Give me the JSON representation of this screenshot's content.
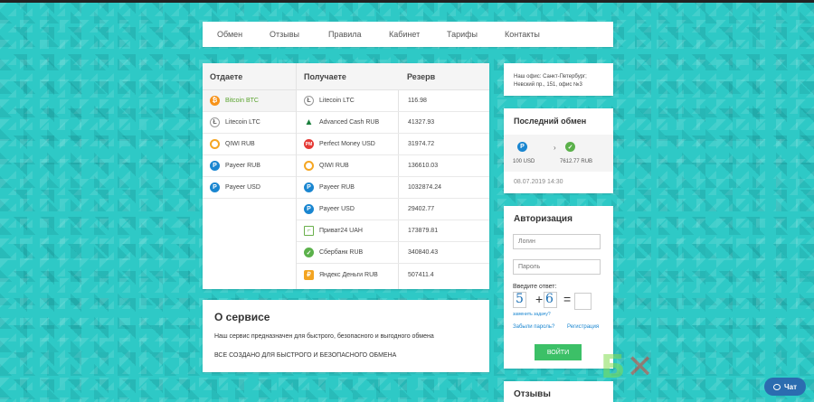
{
  "nav": [
    "Обмен",
    "Отзывы",
    "Правила",
    "Кабинет",
    "Тарифы",
    "Контакты"
  ],
  "exchange": {
    "headers": {
      "give": "Отдаете",
      "get": "Получаете",
      "reserve": "Резерв"
    },
    "give": [
      {
        "icon": "bitcoin-icon",
        "label": "Bitcoin BTC",
        "active": true
      },
      {
        "icon": "litecoin-icon",
        "label": "Litecoin LTC"
      },
      {
        "icon": "qiwi-icon",
        "label": "QIWI RUB"
      },
      {
        "icon": "payeer-icon",
        "label": "Payeer RUB"
      },
      {
        "icon": "payeer-icon",
        "label": "Payeer USD"
      }
    ],
    "get": [
      {
        "icon": "litecoin-icon",
        "label": "Litecoin LTC",
        "reserve": "116.98"
      },
      {
        "icon": "advcash-icon",
        "label": "Advanced Cash RUB",
        "reserve": "41327.93"
      },
      {
        "icon": "perfect-money-icon",
        "label": "Perfect Money USD",
        "reserve": "31974.72"
      },
      {
        "icon": "qiwi-icon",
        "label": "QIWI RUB",
        "reserve": "136610.03"
      },
      {
        "icon": "payeer-icon",
        "label": "Payeer RUB",
        "reserve": "1032874.24"
      },
      {
        "icon": "payeer-icon",
        "label": "Payeer USD",
        "reserve": "29402.77"
      },
      {
        "icon": "privat24-icon",
        "label": "Приват24 UAH",
        "reserve": "173879.81"
      },
      {
        "icon": "sberbank-icon",
        "label": "Сбербанк RUB",
        "reserve": "340840.43"
      },
      {
        "icon": "yandex-money-icon",
        "label": "Яндекс Деньги RUB",
        "reserve": "507411.4"
      }
    ]
  },
  "about": {
    "title": "О сервисе",
    "text1": "Наш сервис предназначен для быстрого, безопасного и выгодного обмена",
    "text2": "ВСЕ СОЗДАНО ДЛЯ БЫСТРОГО И БЕЗОПАСНОГО ОБМЕНА"
  },
  "office": "Наш офис: Санкт-Петербург; Невский пр., 151, офис №3",
  "last_exchange": {
    "title": "Последний обмен",
    "from_amount": "100 USD",
    "to_amount": "7612.77 RUB",
    "date": "08.07.2019 14:30"
  },
  "auth": {
    "title": "Авторизация",
    "login_placeholder": "Логин",
    "password_placeholder": "Пароль",
    "question": "Введите ответ:",
    "captcha_a": "5",
    "plus": "+",
    "captcha_b": "6",
    "equals": "=",
    "change": "заменить задачу?",
    "forgot": "Забыли пароль?",
    "register": "Регистрация",
    "submit": "ВОЙТИ"
  },
  "reviews": {
    "title": "Отзывы"
  },
  "chat": {
    "label": "Чат"
  },
  "colors": {
    "accent": "#3cc067",
    "background": "#2ec9c6",
    "link": "#1a86d0"
  }
}
